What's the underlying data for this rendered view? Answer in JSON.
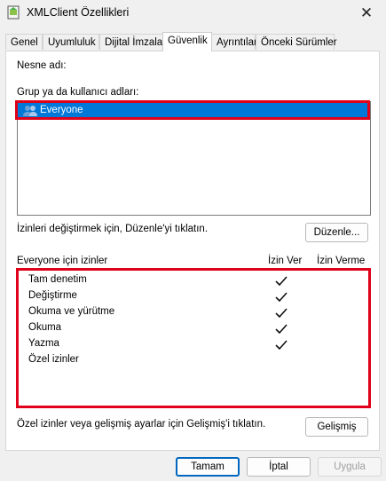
{
  "window": {
    "title": "XMLClient Özellikleri",
    "close_glyph": "✕"
  },
  "tabs": [
    {
      "label": "Genel"
    },
    {
      "label": "Uyumluluk"
    },
    {
      "label": "Dijital İmzalar"
    },
    {
      "label": "Güvenlik"
    },
    {
      "label": "Ayrıntılar"
    },
    {
      "label": "Önceki Sürümler"
    }
  ],
  "security": {
    "object_name_label": "Nesne adı:",
    "object_name_value": "",
    "groups_label": "Grup ya da kullanıcı adları:",
    "groups": [
      {
        "name": "Everyone",
        "icon": "users-icon",
        "selected": true
      }
    ],
    "edit_hint": "İzinleri değiştirmek için, Düzenle'yi tıklatın.",
    "edit_button": "Düzenle...",
    "permissions_header": "Everyone için izinler",
    "allow_header": "İzin Ver",
    "deny_header": "İzin Verme",
    "permissions": [
      {
        "name": "Tam denetim",
        "allow": true,
        "deny": false
      },
      {
        "name": "Değiştirme",
        "allow": true,
        "deny": false
      },
      {
        "name": "Okuma ve yürütme",
        "allow": true,
        "deny": false
      },
      {
        "name": "Okuma",
        "allow": true,
        "deny": false
      },
      {
        "name": "Yazma",
        "allow": true,
        "deny": false
      },
      {
        "name": "Özel izinler",
        "allow": false,
        "deny": false
      }
    ],
    "advanced_hint": "Özel izinler veya gelişmiş ayarlar için Gelişmiş'i tıklatın.",
    "advanced_button": "Gelişmiş"
  },
  "footer": {
    "ok": "Tamam",
    "cancel": "İptal",
    "apply": "Uygula"
  },
  "colors": {
    "selection": "#0078d7",
    "highlight_box": "#e0001a",
    "primary_border": "#0067c0"
  }
}
